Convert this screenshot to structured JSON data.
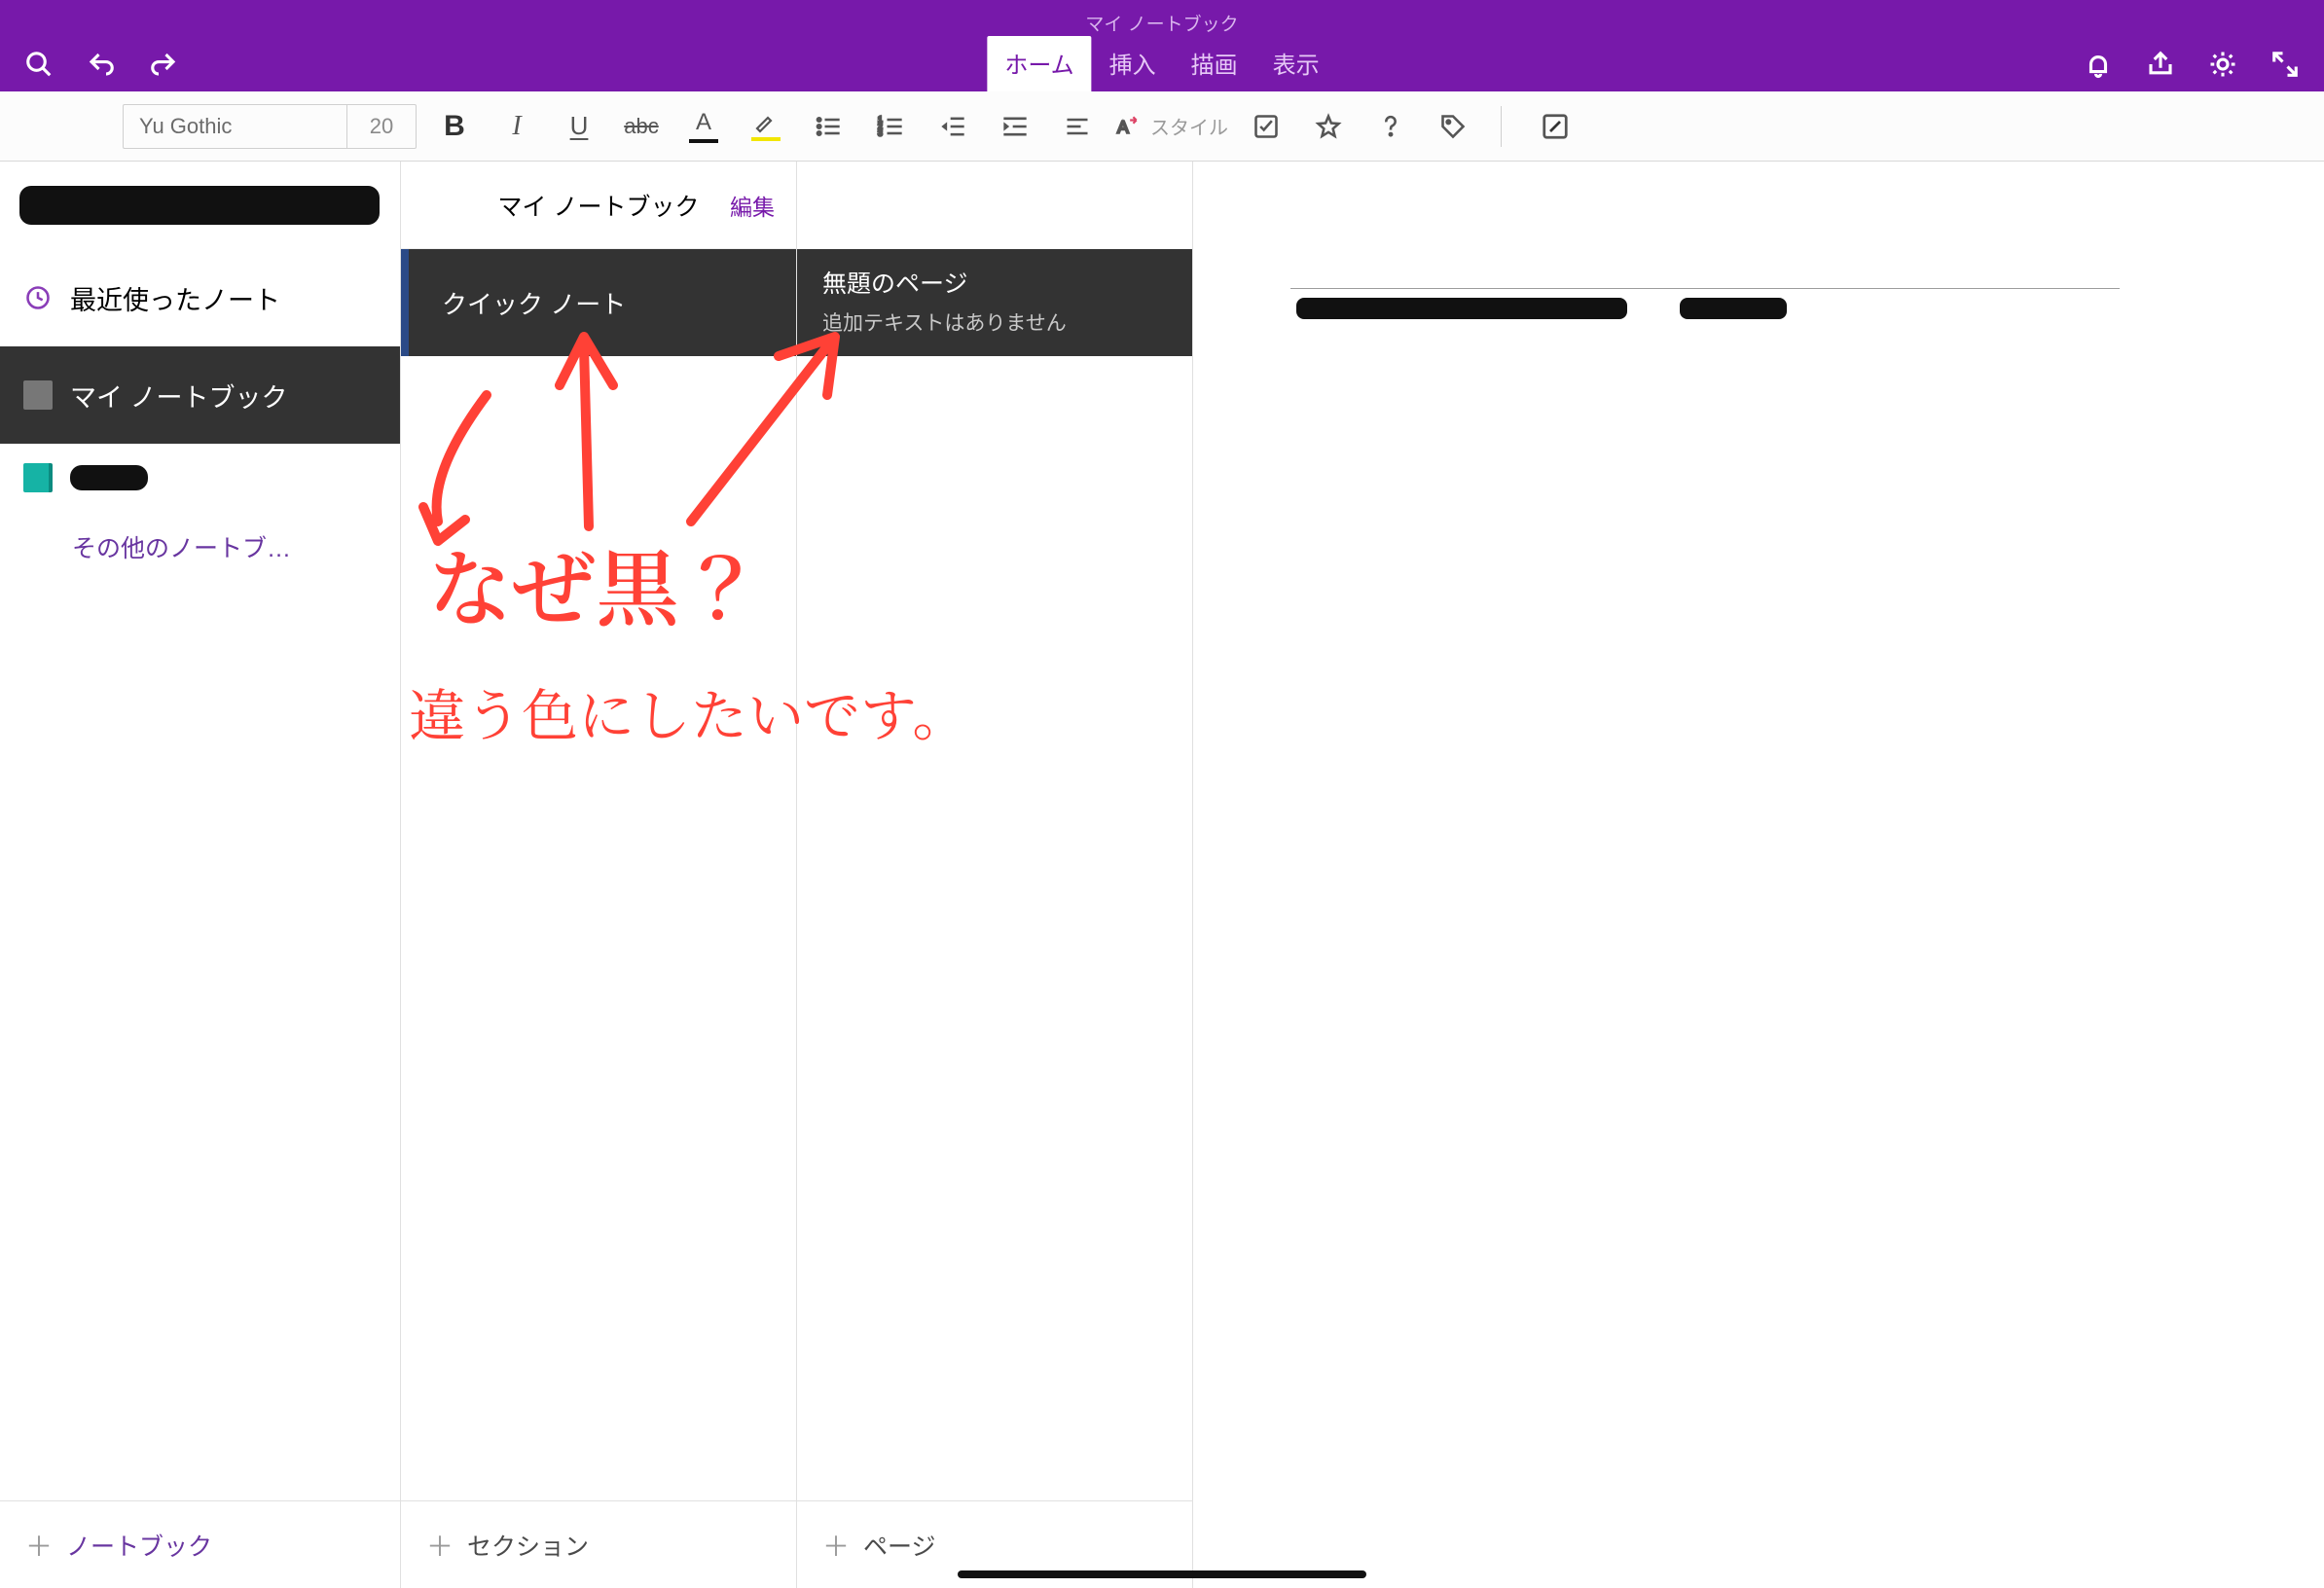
{
  "app_title": "マイ ノートブック",
  "tabs": {
    "home": "ホーム",
    "insert": "挿入",
    "draw": "描画",
    "view": "表示"
  },
  "toolbar": {
    "font_name": "Yu Gothic",
    "font_size": "20",
    "style_label": "スタイル"
  },
  "sidebar": {
    "recent": "最近使ったノート",
    "notebook_active": "マイ ノートブック",
    "more_notebooks": "その他のノートブ…",
    "add_notebook": "ノートブック"
  },
  "sections": {
    "panel_title": "マイ ノートブック",
    "edit_label": "編集",
    "active_section": "クイック ノート",
    "add_section": "セクション"
  },
  "pages": {
    "page_title": "無題のページ",
    "page_sub": "追加テキストはありません",
    "add_page": "ページ"
  },
  "annotation": {
    "line1": "なぜ黒？",
    "line2": "違う色にしたいです。"
  },
  "colors": {
    "brand_purple": "#7719aa",
    "annotation_red": "#ff4136"
  }
}
